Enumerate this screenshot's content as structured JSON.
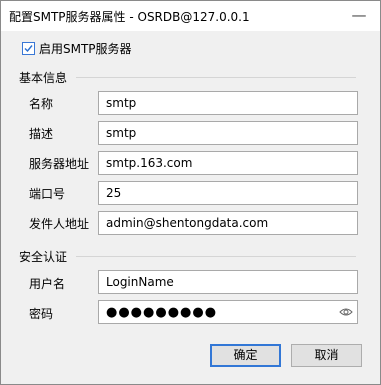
{
  "window": {
    "title": "配置SMTP服务器属性  -  OSRDB@127.0.0.1",
    "close_glyph": "—"
  },
  "enable_smtp": {
    "label": "启用SMTP服务器",
    "checked": true
  },
  "basic_section": {
    "title": "基本信息",
    "fields": {
      "name": {
        "label": "名称",
        "value": "smtp"
      },
      "description": {
        "label": "描述",
        "value": "smtp"
      },
      "server_address": {
        "label": "服务器地址",
        "value": "smtp.163.com"
      },
      "port": {
        "label": "端口号",
        "value": "25"
      },
      "sender_address": {
        "label": "发件人地址",
        "value": "admin@shentongdata.com"
      }
    }
  },
  "security_section": {
    "title": "安全认证",
    "fields": {
      "username": {
        "label": "用户名",
        "value": "LoginName"
      },
      "password": {
        "label": "密码",
        "value": "●●●●●●●●●"
      }
    }
  },
  "buttons": {
    "ok": "确定",
    "cancel": "取消"
  },
  "colors": {
    "accent": "#3277d6",
    "background": "#f0f0f0"
  },
  "icons": {
    "close": "close-icon",
    "checkbox": "checkmark-icon",
    "reveal": "eye-icon"
  }
}
